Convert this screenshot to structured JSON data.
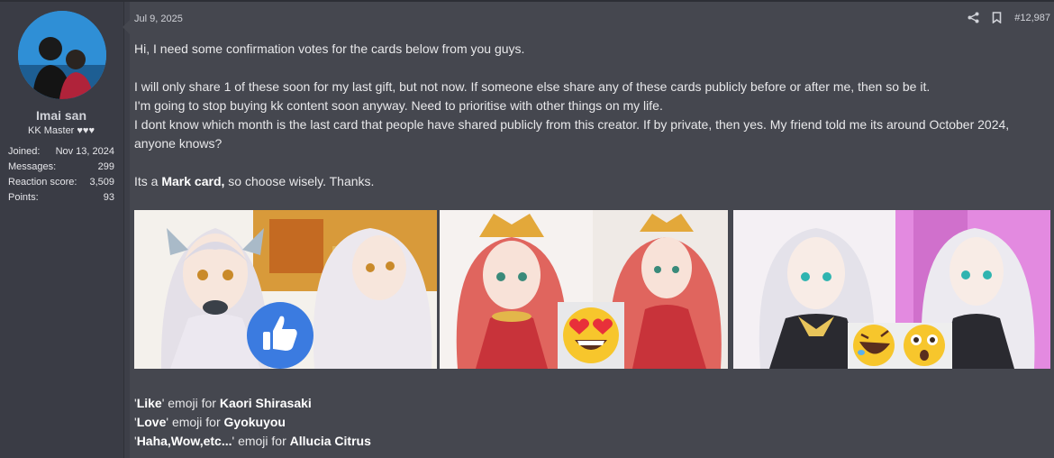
{
  "user": {
    "name": "Imai san",
    "title": "KK Master ♥♥♥",
    "stats": [
      {
        "label": "Joined:",
        "value": "Nov 13, 2024"
      },
      {
        "label": "Messages:",
        "value": "299"
      },
      {
        "label": "Reaction score:",
        "value": "3,509"
      },
      {
        "label": "Points:",
        "value": "93"
      }
    ]
  },
  "post": {
    "date": "Jul 9, 2025",
    "number": "#12,987",
    "share_icon": "share-icon",
    "bookmark_icon": "bookmark-icon",
    "lines": {
      "l1": "Hi, I need some confirmation votes for the cards below from you guys.",
      "l2": "I will only share 1 of these soon for my last gift, but not now. If someone else share any of these cards publicly before or after me, then so be it.",
      "l3": "I'm going to stop buying kk content soon anyway. Need to prioritise with other things on my life.",
      "l4": "I dont know which month is the last card that people have shared publicly from this creator. If by private, then yes. My friend told me its around October 2024, anyone knows?",
      "l5_pre": "Its a ",
      "l5_bold": "Mark card,",
      "l5_post": " so choose wisely. Thanks."
    },
    "cards": [
      {
        "name": "Kaori Shirasaki",
        "emoji": "like-thumbs-up-icon"
      },
      {
        "name": "Gyokuyou",
        "emoji": "heart-eyes-icon"
      },
      {
        "name": "Allucia Citrus",
        "emoji": "haha-wow-icon"
      }
    ],
    "captions": [
      {
        "q1": "'",
        "em": "Like",
        "q2": "' emoji for ",
        "name": "Kaori Shirasaki"
      },
      {
        "q1": "'",
        "em": "Love",
        "q2": "' emoji for ",
        "name": "Gyokuyou"
      },
      {
        "q1": "'",
        "em": "Haha,Wow,etc...",
        "q2": "' emoji for ",
        "name": "Allucia Citrus"
      }
    ]
  }
}
